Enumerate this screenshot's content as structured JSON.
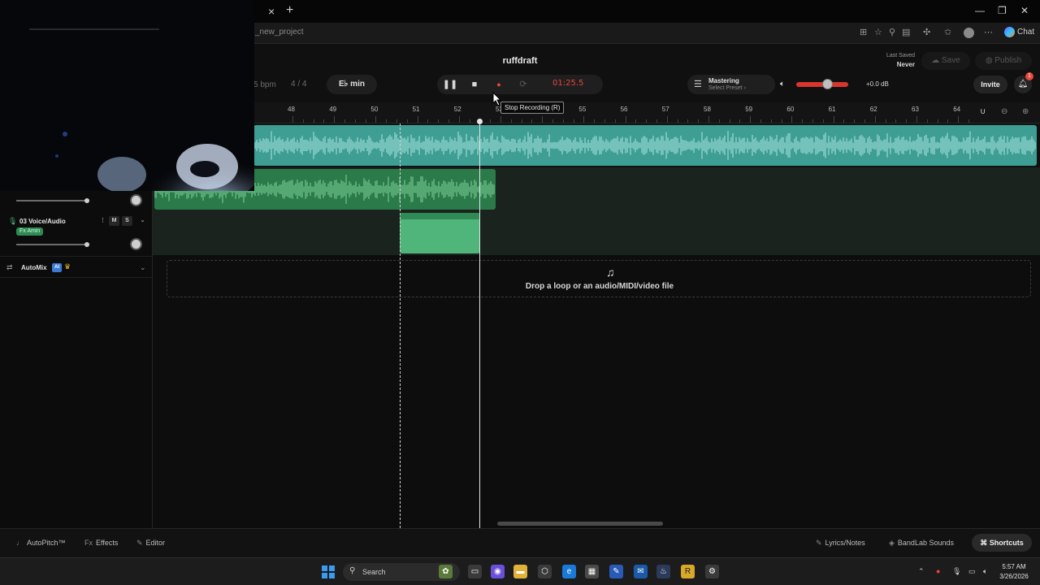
{
  "browser": {
    "tab_close": "×",
    "tab_new": "+",
    "url": "_new_project",
    "chat_label": "Chat",
    "window_controls": [
      "—",
      "❐",
      "✕"
    ]
  },
  "header": {
    "project_title": "ruffdraft",
    "bpm": "5 bpm",
    "time_signature": "4 / 4",
    "key": "E♭ min",
    "last_saved_label": "Last Saved",
    "last_saved_value": "Never",
    "save_label": "Save",
    "publish_label": "Publish",
    "invite_label": "Invite",
    "notification_count": "1"
  },
  "transport": {
    "time": "01:25.5",
    "record_color": "#e8473a"
  },
  "mastering": {
    "label": "Mastering",
    "preset": "Select Preset ›"
  },
  "volume": {
    "db": "+0.0 dB",
    "level_fraction": 0.6
  },
  "ruler": {
    "bars": [
      "48",
      "49",
      "50",
      "51",
      "52",
      "53",
      "54",
      "55",
      "56",
      "57",
      "58",
      "59",
      "60",
      "61",
      "62",
      "63",
      "64"
    ]
  },
  "tracks": [
    {
      "number": "03",
      "name": "Voice/Audio",
      "effect": "Fx Amin",
      "mute": "M",
      "solo": "S"
    }
  ],
  "automix": {
    "label": "AutoMix",
    "badge": "AI"
  },
  "dropzone": {
    "text": "Drop a loop or an audio/MIDI/video file"
  },
  "tooltip": {
    "text": "Stop Recording (R)"
  },
  "bottom_bar": {
    "autopitch": "AutoPitch™",
    "effects": "Effects",
    "editor": "Editor",
    "lyrics": "Lyrics/Notes",
    "sounds": "BandLab Sounds",
    "shortcuts": "Shortcuts"
  },
  "taskbar": {
    "search_placeholder": "Search",
    "time": "5:57 AM",
    "date": "3/26/2026"
  },
  "colors": {
    "accent_red": "#e8473a",
    "track1_clip": "#3e9e94",
    "track2_clip": "#2b7a4a",
    "track3_clip": "#4fb57a"
  }
}
